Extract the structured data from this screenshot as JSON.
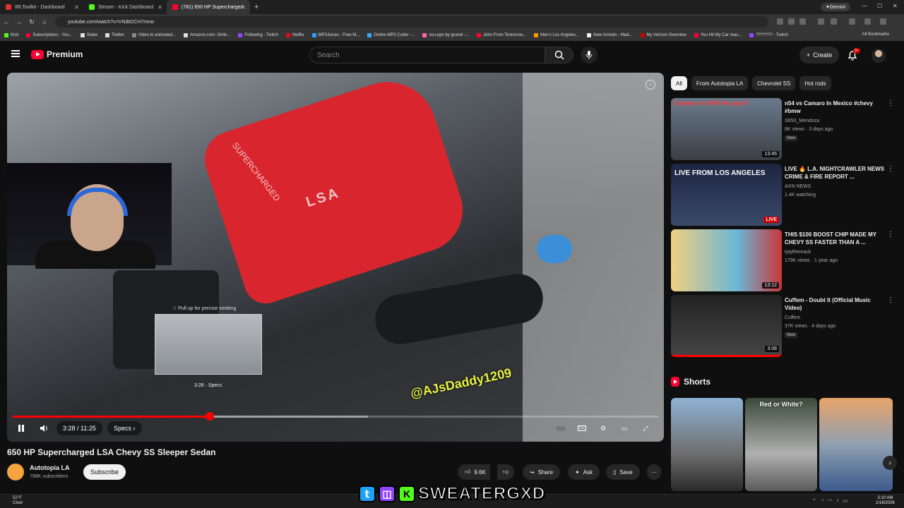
{
  "browser": {
    "tabs": [
      {
        "title": "IRLToolkit - Dashboard",
        "color": "#e03030"
      },
      {
        "title": "Stream - Kick Dashboard",
        "color": "#53fc18"
      },
      {
        "title": "(781) 650 HP Supercharged",
        "color": "#ff0033"
      }
    ],
    "gemini_label": "Gemini",
    "url": "youtube.com/watch?v=VNd82CH7mnw",
    "bookmarks": [
      {
        "label": "Kick",
        "color": "#53fc18"
      },
      {
        "label": "Subscriptions - You...",
        "color": "#ff0033"
      },
      {
        "label": "Stake",
        "color": "#ddd"
      },
      {
        "label": "Twitter",
        "color": "#ddd"
      },
      {
        "label": "Video to animated...",
        "color": "#888"
      },
      {
        "label": "Amazon.com: Onlin...",
        "color": "#ddd"
      },
      {
        "label": "Following - Twitch",
        "color": "#9146ff"
      },
      {
        "label": "Netflix",
        "color": "#e50914"
      },
      {
        "label": "MP3Juices - Free M...",
        "color": "#3399ff"
      },
      {
        "label": "Online MP3 Cutter -...",
        "color": "#33aaff"
      },
      {
        "label": "osu-pps by grumd -...",
        "color": "#ff66aa"
      },
      {
        "label": "John From Tennesse...",
        "color": "#ff0033"
      },
      {
        "label": "Men's Los Angeles...",
        "color": "#ff9900"
      },
      {
        "label": "New Arrivals - Mad...",
        "color": "#eee"
      },
      {
        "label": "My Verizon Overview",
        "color": "#cc0000"
      },
      {
        "label": "You Hit My Car reac...",
        "color": "#ff0033"
      },
      {
        "label": "??????? - Twitch",
        "color": "#9146ff"
      }
    ],
    "all_bookmarks": "All Bookmarks"
  },
  "header": {
    "logo_text": "Premium",
    "search_placeholder": "Search",
    "create_label": "Create",
    "notif_count": "9+"
  },
  "player": {
    "current_time": "3:28",
    "duration": "11:25",
    "time_label": "3:28 / 11:25",
    "progress": 0.305,
    "buffered": 0.55,
    "chapter_label": "Specs",
    "seek_hint": "Pull up for precise seeking",
    "seek_preview_time": "3:28 · Specs",
    "watermark": "@AJsDaddy1209"
  },
  "video": {
    "title": "650 HP Supercharged LSA Chevy SS Sleeper Sedan",
    "channel": "Autotopia LA",
    "subscribers": "798K subscribers",
    "subscribe_label": "Subscribe",
    "likes": "9.6K",
    "share_label": "Share",
    "ask_label": "Ask",
    "save_label": "Save"
  },
  "chips": [
    "All",
    "From Autotopia LA",
    "Chevrolet SS",
    "Hot rods"
  ],
  "recommendations": [
    {
      "title": "n54 vs Camaro In Mexico #chevy #bmw",
      "channel": "S650_Mendoza",
      "meta": "8K views · 3 days ago",
      "badge": "New",
      "duration": "13:45",
      "thumb_caption": "Camaro vs N54  No pay?!"
    },
    {
      "title": "LIVE 🔥 L.A. NIGHTCRAWLER NEWS CRIME & FIRE REPORT ...",
      "channel": "AXN NEWS",
      "meta": "1.4K watching",
      "badge": "",
      "duration": "LIVE",
      "thumb_caption": "LIVE FROM LOS ANGELES"
    },
    {
      "title": "THIS $100 BOOST CHIP MADE MY CHEVY SS FASTER THAN A ...",
      "channel": "tytythemack",
      "meta": "179K views · 1 year ago",
      "badge": "",
      "duration": "13:12",
      "thumb_caption": ""
    },
    {
      "title": "Cuffem - Doubt It (Official Music Video)",
      "channel": "Cuffem",
      "meta": "37K views · 4 days ago",
      "badge": "New",
      "duration": "3:08",
      "thumb_caption": ""
    }
  ],
  "shorts": {
    "heading": "Shorts",
    "items": [
      {
        "caption": ""
      },
      {
        "caption": "Red or White?"
      },
      {
        "caption": ""
      }
    ]
  },
  "taskbar": {
    "temp": "52°F",
    "condition": "Clear",
    "time": "3:10 AM",
    "date": "1/16/2026"
  },
  "stream_overlay": {
    "name": "SWEATERGXD"
  }
}
